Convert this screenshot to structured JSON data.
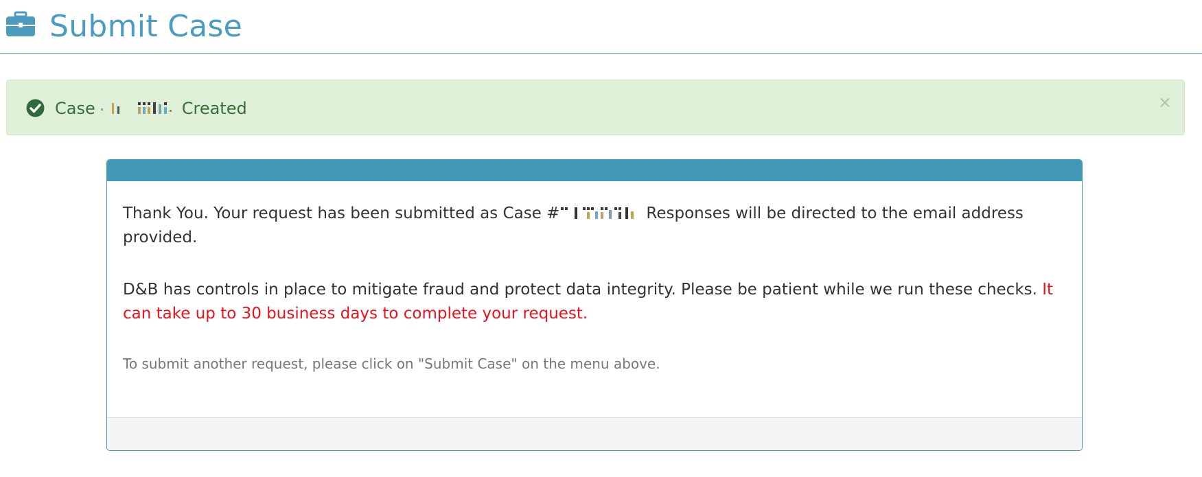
{
  "header": {
    "title": "Submit Case",
    "icon": "briefcase-icon",
    "title_color": "#4b9cbf"
  },
  "alert": {
    "icon": "check-circle-icon",
    "prefix": "Case",
    "suffix": "Created",
    "close_label": "×",
    "background": "#dff0d8"
  },
  "panel": {
    "heading_color": "#4298b7",
    "para1_before": "Thank You. Your request has been submitted as Case #",
    "para1_after": "Responses will be directed to the email address provided.",
    "para2_normal": "D&B has controls in place to mitigate fraud and protect data integrity. Please be patient while we run these checks.",
    "para2_red": "It can take up to 30 business days to complete your request.",
    "note": "To submit another request, please click on \"Submit Case\" on the menu above."
  }
}
